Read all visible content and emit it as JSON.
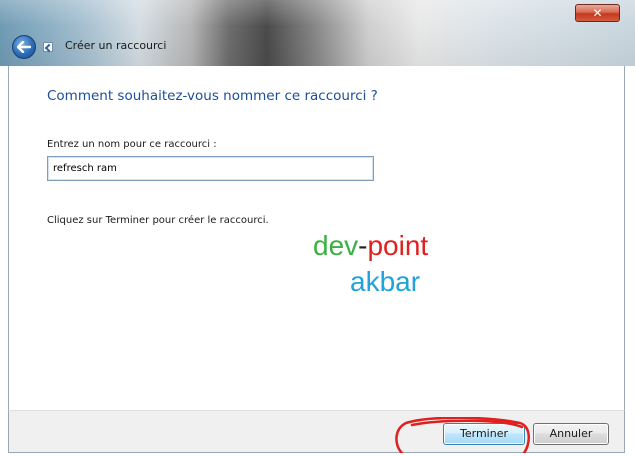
{
  "window": {
    "title": "Créer un raccourci",
    "close_symbol": "✕"
  },
  "icons": {
    "back": "back-arrow-icon",
    "shortcut": "shortcut-icon"
  },
  "wizard": {
    "heading": "Comment souhaitez-vous nommer ce raccourci ?",
    "field_label": "Entrez un nom pour ce raccourci :",
    "field_value": "refresch ram",
    "instruction": "Cliquez sur Terminer pour créer le raccourci."
  },
  "watermark": {
    "dev": "dev",
    "separator": "-",
    "point": "point",
    "author": "akbar",
    "colors": {
      "dev": "#3cb043",
      "point": "#e0201e",
      "author": "#1fa3d8"
    }
  },
  "buttons": {
    "finish": "Terminer",
    "cancel": "Annuler"
  },
  "colors": {
    "heading": "#1b4e9b",
    "annotation": "#e0201e"
  }
}
